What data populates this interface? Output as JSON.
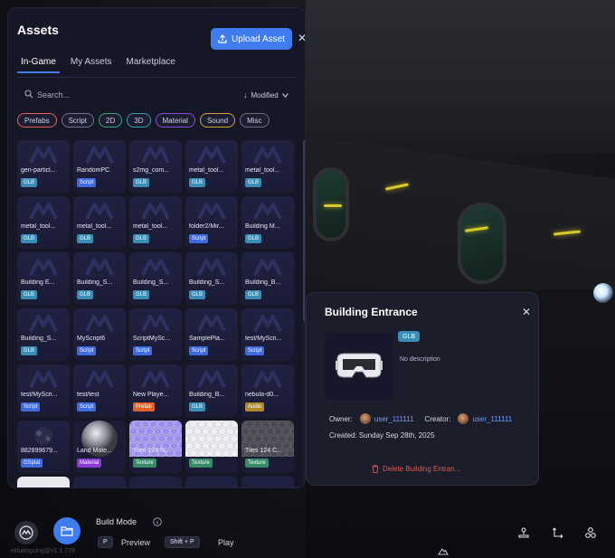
{
  "panel": {
    "title": "Assets",
    "upload_label": "Upload Asset",
    "tabs": [
      "In-Game",
      "My Assets",
      "Marketplace"
    ],
    "active_tab": "In-Game",
    "search_placeholder": "Search...",
    "sort_label": "Modified",
    "filters": [
      {
        "label": "Prefabs",
        "color": "#e0605a"
      },
      {
        "label": "Script",
        "color": "#6a7490"
      },
      {
        "label": "2D",
        "color": "#3aa37a"
      },
      {
        "label": "3D",
        "color": "#3a9ab0"
      },
      {
        "label": "Material",
        "color": "#8a48d8"
      },
      {
        "label": "Sound",
        "color": "#d0a03a"
      },
      {
        "label": "Misc",
        "color": "#6a6e84"
      }
    ]
  },
  "assets": [
    {
      "name": "gen-particl...",
      "type": "GLB"
    },
    {
      "name": "RandomPC",
      "type": "Script"
    },
    {
      "name": "s2mg_com...",
      "type": "GLB"
    },
    {
      "name": "metal_tool...",
      "type": "GLB"
    },
    {
      "name": "metal_tool...",
      "type": "GLB"
    },
    {
      "name": "metal_tool...",
      "type": "GLB"
    },
    {
      "name": "metal_tool...",
      "type": "GLB"
    },
    {
      "name": "metal_tool...",
      "type": "GLB"
    },
    {
      "name": "folder2/Mir...",
      "type": "Script"
    },
    {
      "name": "Building M...",
      "type": "GLB"
    },
    {
      "name": "Building E...",
      "type": "GLB"
    },
    {
      "name": "Building_S...",
      "type": "GLB"
    },
    {
      "name": "Building_S...",
      "type": "GLB"
    },
    {
      "name": "Building_S...",
      "type": "GLB"
    },
    {
      "name": "Building_B...",
      "type": "GLB"
    },
    {
      "name": "Building_S...",
      "type": "GLB"
    },
    {
      "name": "MyScript6",
      "type": "Script"
    },
    {
      "name": "ScriptMySc...",
      "type": "Script"
    },
    {
      "name": "SamplePla...",
      "type": "Script"
    },
    {
      "name": "test/MyScri...",
      "type": "Script"
    },
    {
      "name": "test/MyScri...",
      "type": "Script"
    },
    {
      "name": "test/test",
      "type": "Script"
    },
    {
      "name": "New Playe...",
      "type": "Prefab"
    },
    {
      "name": "Building_B...",
      "type": "GLB"
    },
    {
      "name": "nebula-d0...",
      "type": "Audio"
    },
    {
      "name": "882899679...",
      "type": "GSplat"
    },
    {
      "name": "Land Mate...",
      "type": "Material"
    },
    {
      "name": "Tiles 124 N...",
      "type": "Texture"
    },
    {
      "name": "Tiles 124 Di...",
      "type": "Texture"
    },
    {
      "name": "Tiles 124 C...",
      "type": "Texture"
    }
  ],
  "badge_colors": {
    "GLB": "#3a8db4",
    "Script": "#3f6ae0",
    "Prefab": "#e0602a",
    "Audio": "#b08a2a",
    "GSplat": "#3f6ae0",
    "Material": "#8a3ad8",
    "Texture": "#3a8a6a"
  },
  "detail": {
    "title": "Building Entrance",
    "type": "GLB",
    "description": "No description",
    "owner_label": "Owner:",
    "owner_name": "user_111111",
    "creator_label": "Creator:",
    "creator_name": "user_111111",
    "created": "Created: Sunday Sep 28th, 2025",
    "delete_label": "Delete Building Entran..."
  },
  "bottom": {
    "build_mode_label": "Build Mode",
    "preview_key": "P",
    "preview_label": "Preview",
    "play_key": "Shift + P",
    "play_label": "Play",
    "version": "Hibaloguing@v1.1.779"
  }
}
